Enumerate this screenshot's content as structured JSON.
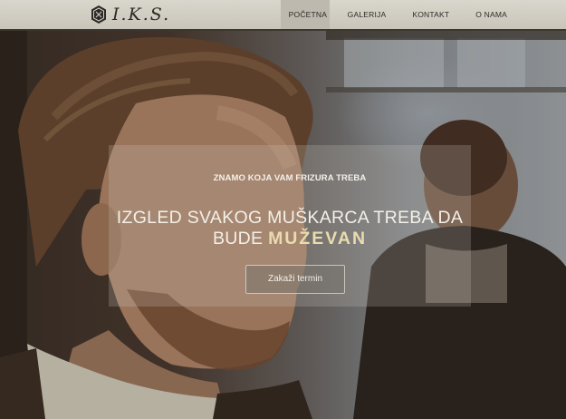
{
  "logo": {
    "text": "I.K.S.",
    "icon": "hexagon-crest-icon"
  },
  "nav": {
    "items": [
      {
        "label": "Početna",
        "active": true
      },
      {
        "label": "Galerija",
        "active": false
      },
      {
        "label": "Kontakt",
        "active": false
      },
      {
        "label": "O nama",
        "active": false
      }
    ]
  },
  "hero": {
    "tagline": "ZNAMO KOJA VAM FRIZURA TREBA",
    "headline_line1": "IZGLED SVAKOG MUŠKARCA TREBA DA",
    "headline_line2_prefix": "BUDE",
    "headline_accent": "MUŽEVAN",
    "cta_label": "Zakaži termin"
  },
  "colors": {
    "navbar_bg": "#d2cfc5",
    "active_nav_bg": "#bdb9ae",
    "accent_text": "#e9dcae",
    "overlay_bg": "rgba(210,205,195,0.22)"
  }
}
